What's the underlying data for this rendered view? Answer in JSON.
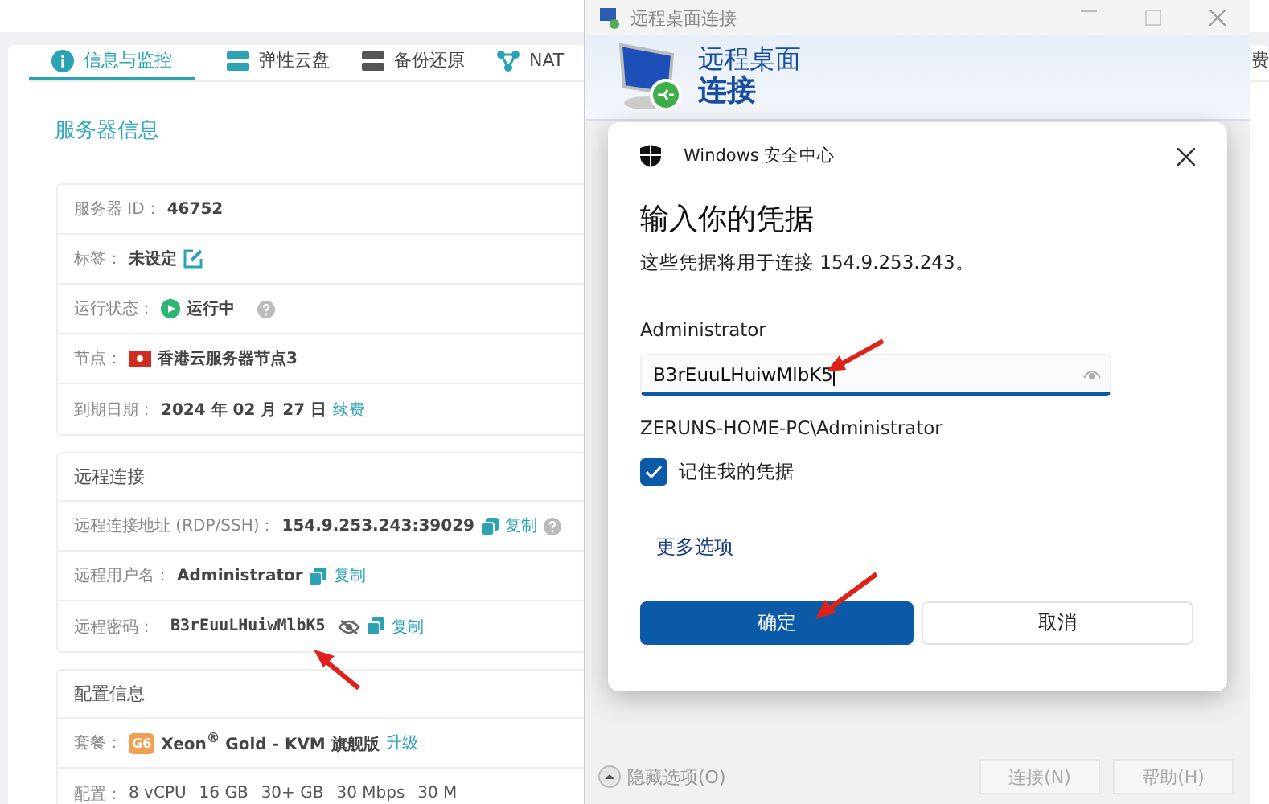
{
  "tabs": [
    {
      "label": "信息与监控",
      "selected": true
    },
    {
      "label": "弹性云盘",
      "selected": false
    },
    {
      "label": "备份还原",
      "selected": false
    },
    {
      "label": "NAT",
      "selected": false
    },
    {
      "label": "费",
      "selected": false
    }
  ],
  "server_info": {
    "title": "服务器信息",
    "rows": [
      {
        "kind": "plain",
        "label": "服务器 ID：",
        "value": "46752"
      },
      {
        "kind": "edit",
        "label": "标签：",
        "value": "未设定"
      },
      {
        "kind": "status",
        "label": "运行状态：",
        "value": "运行中"
      },
      {
        "kind": "flag",
        "label": "节点：",
        "value": "香港云服务器节点3"
      },
      {
        "kind": "link",
        "label": "到期日期：",
        "value": "2024 年 02 月 27 日",
        "link": "续费"
      }
    ]
  },
  "remote": {
    "title": "远程连接",
    "rows": [
      {
        "kind": "copy",
        "label": "远程连接地址 (RDP/SSH)：",
        "value": "154.9.253.243:39029",
        "action": "复制",
        "help": true
      },
      {
        "kind": "copy",
        "label": "远程用户名：",
        "value": "Administrator",
        "action": "复制",
        "help": false
      },
      {
        "kind": "password",
        "label": "远程密码：",
        "value": "B3rEuuLHuiwMlbK5",
        "action": "复制",
        "help": false
      }
    ]
  },
  "config": {
    "title": "配置信息",
    "plan": {
      "label": "套餐：",
      "badge": "G6",
      "value": "Xeon$^{®}$ Gold - KVM 旗舰版",
      "link": "升级"
    },
    "specs": {
      "label": "配置：",
      "items": [
        "8 vCPU",
        "16 GB",
        "30+ GB",
        "30 Mbps",
        "30 M"
      ]
    }
  },
  "rdp_window": {
    "title": "远程桌面连接",
    "heading_line_1": "远程桌面",
    "heading_line_2": "连接",
    "hide_options": "隐藏选项(O)",
    "buttons": [
      {
        "label": "连接(N)",
        "disabled": true
      },
      {
        "label": "帮助(H)",
        "disabled": true
      }
    ]
  },
  "credential_dialog": {
    "source": "Windows 安全中心",
    "title": "输入你的凭据",
    "description": "这些凭据将用于连接 154.9.253.243。",
    "username": "Administrator",
    "password_value": "B3rEuuLHuiwMlbK5",
    "account": "ZERUNS-HOME-PC\\Administrator",
    "remember": {
      "label": "记住我的凭据",
      "checked": true
    },
    "more_options": "更多选项",
    "ok": "确定",
    "cancel": "取消"
  }
}
